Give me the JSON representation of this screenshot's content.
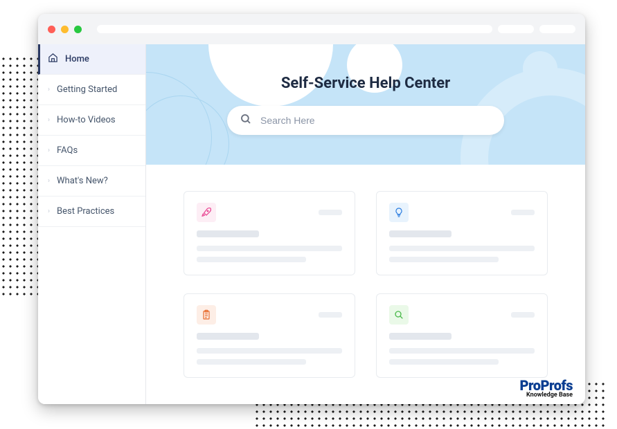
{
  "sidebar": {
    "items": [
      {
        "label": "Home",
        "active": true
      },
      {
        "label": "Getting Started",
        "active": false
      },
      {
        "label": "How-to Videos",
        "active": false
      },
      {
        "label": "FAQs",
        "active": false
      },
      {
        "label": "What's New?",
        "active": false
      },
      {
        "label": "Best Practices",
        "active": false
      }
    ]
  },
  "hero": {
    "title": "Self-Service Help Center",
    "search_placeholder": "Search Here"
  },
  "cards": [
    {
      "icon": "rocket-icon",
      "icon_class": "ib-pink"
    },
    {
      "icon": "bulb-icon",
      "icon_class": "ib-blue"
    },
    {
      "icon": "clipboard-icon",
      "icon_class": "ib-orange"
    },
    {
      "icon": "search-icon",
      "icon_class": "ib-green"
    }
  ],
  "branding": {
    "name_1": "Pro",
    "name_2": "Profs",
    "subtitle": "Knowledge Base"
  }
}
